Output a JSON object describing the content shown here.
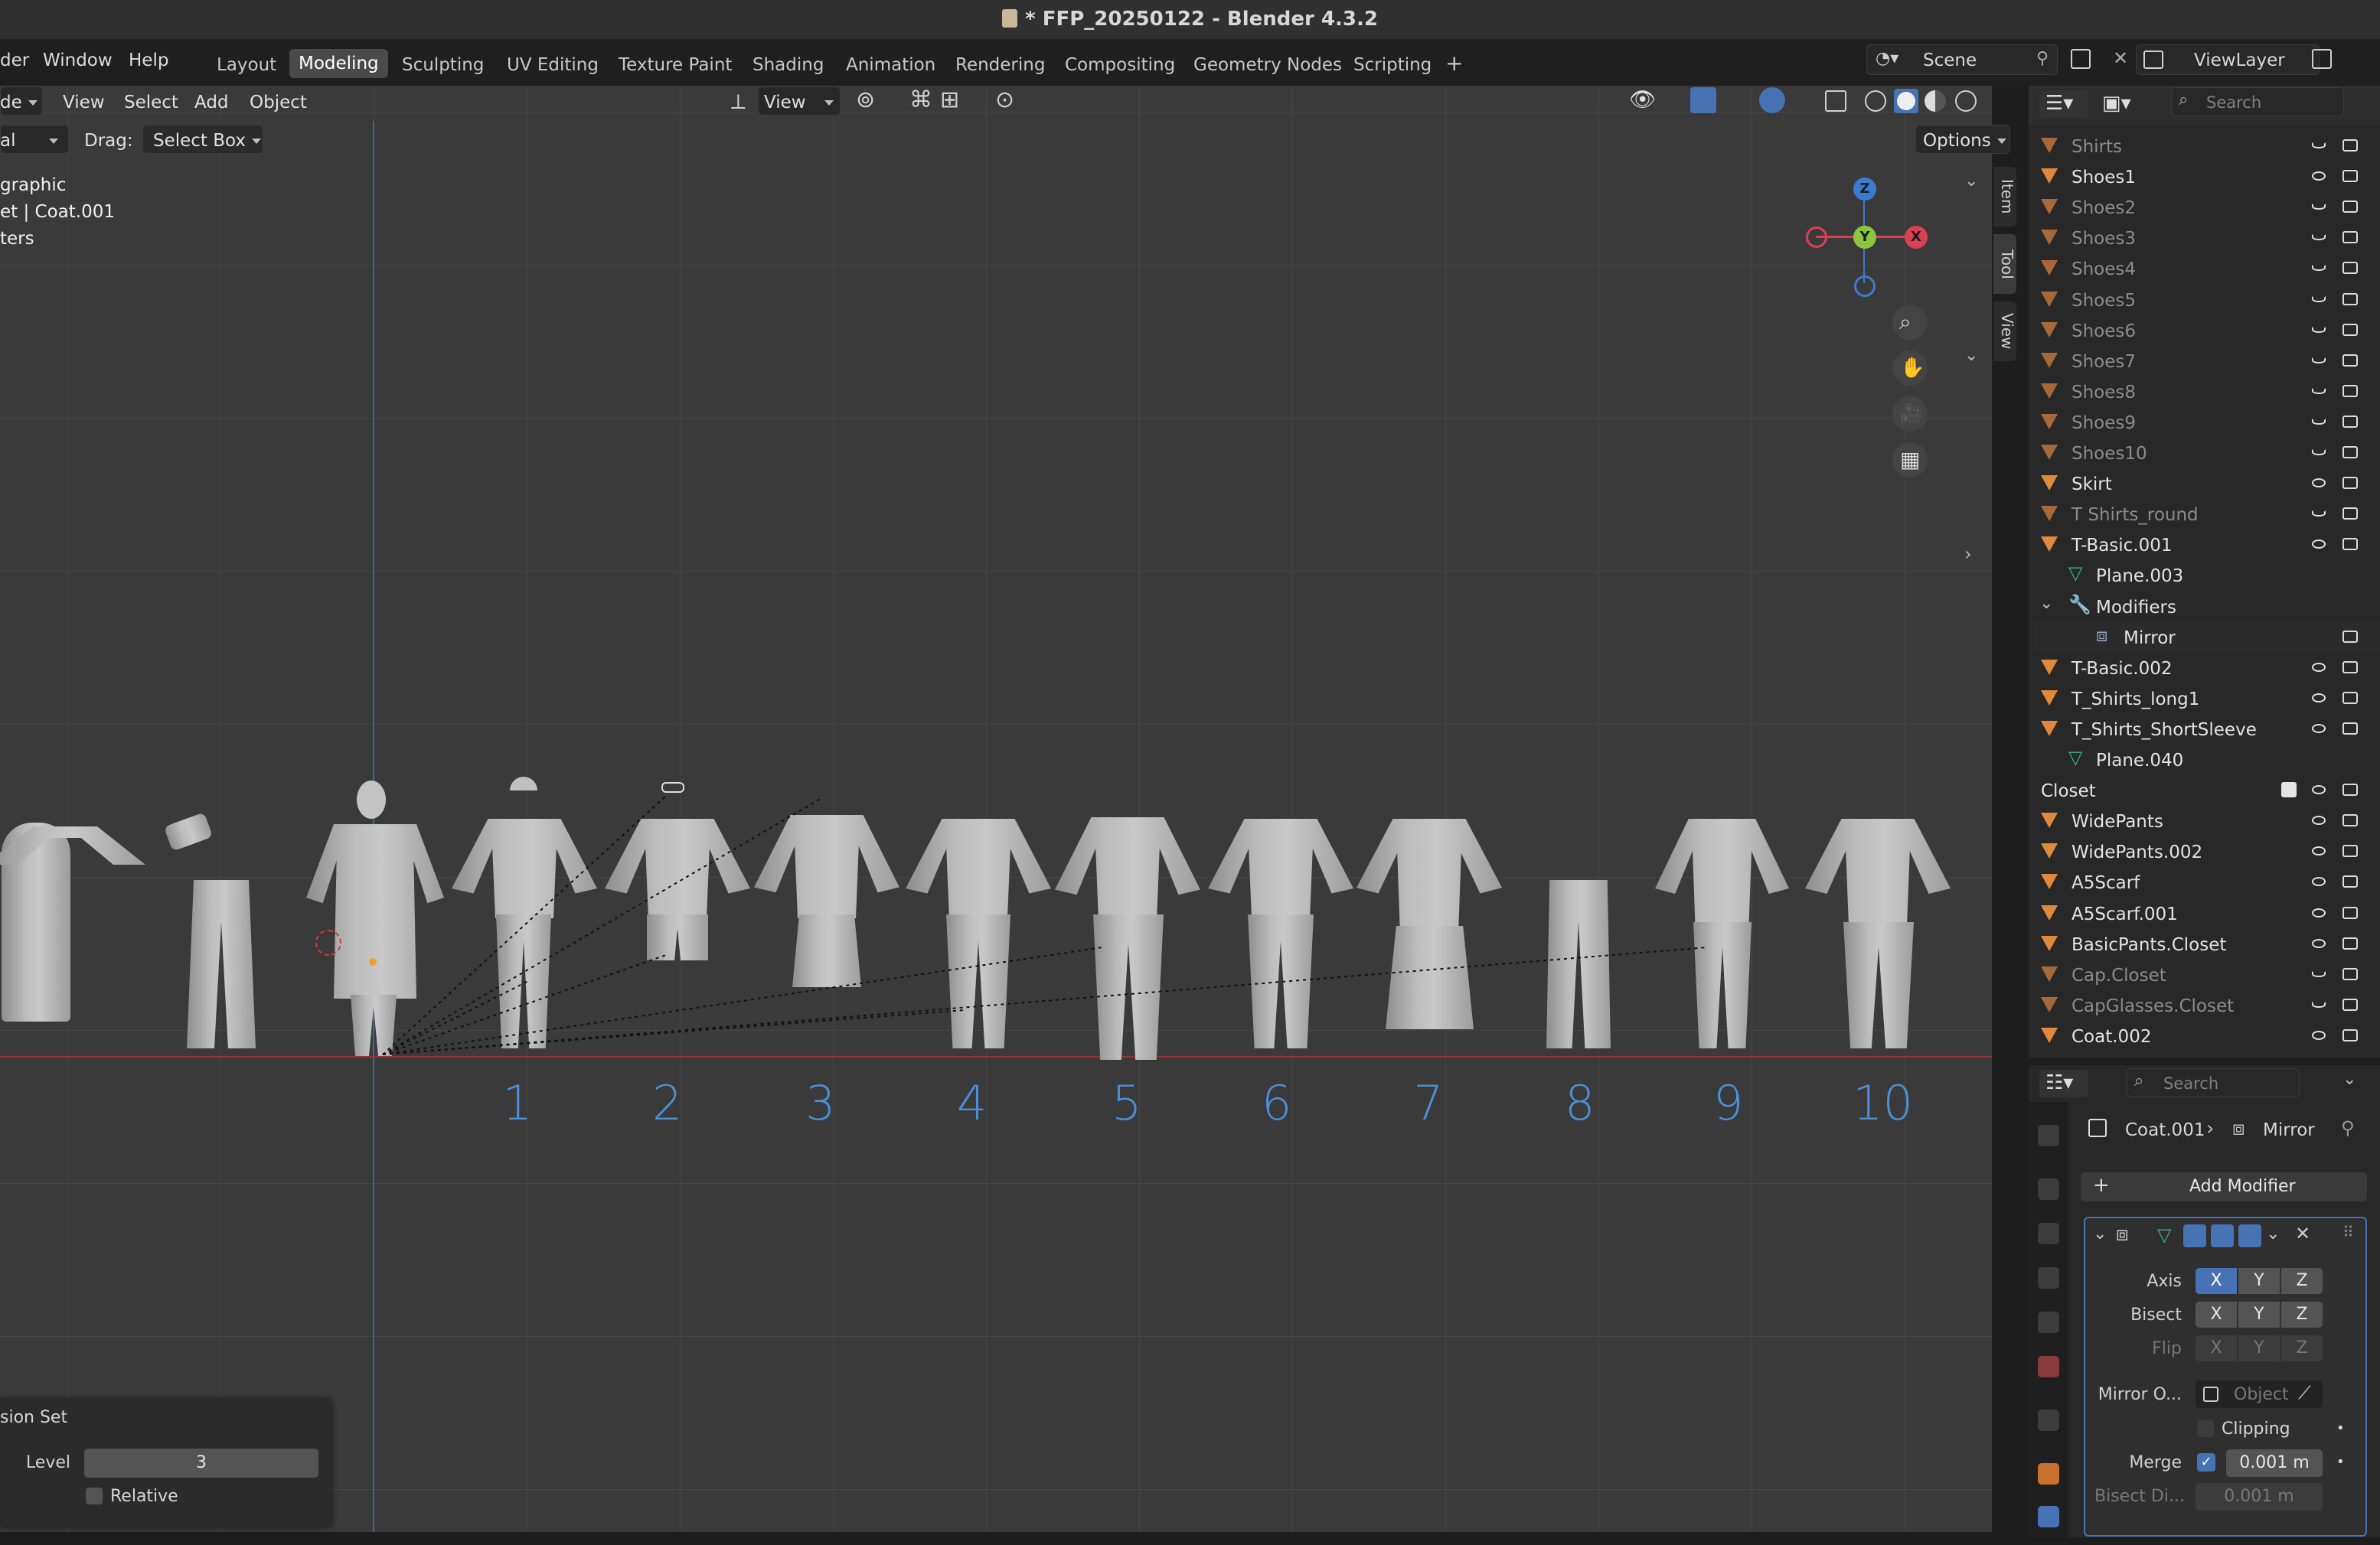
{
  "window": {
    "title": "* FFP_20250122 - Blender 4.3.2"
  },
  "menus": {
    "render": "der",
    "window": "Window",
    "help": "Help"
  },
  "workspaces": [
    "Layout",
    "Modeling",
    "Sculpting",
    "UV Editing",
    "Texture Paint",
    "Shading",
    "Animation",
    "Rendering",
    "Compositing",
    "Geometry Nodes",
    "Scripting"
  ],
  "active_workspace": "Modeling",
  "scene": {
    "label": "Scene",
    "view_layer": "ViewLayer"
  },
  "viewport_header": {
    "mode": "de",
    "view": "View",
    "select": "Select",
    "add": "Add",
    "object": "Object",
    "orientation": "View",
    "drag_label": "Drag:",
    "drag_value": "Select Box",
    "transform_partial": "al",
    "options": "Options"
  },
  "viewport_info": {
    "line1": "graphic",
    "line2": "et | Coat.001",
    "line3": "ters"
  },
  "side_tabs": [
    "Item",
    "Tool",
    "View"
  ],
  "gizmo": {
    "x": "X",
    "y": "Y",
    "z": "Z"
  },
  "ground_numbers": [
    "1",
    "2",
    "3",
    "4",
    "5",
    "6",
    "7",
    "8",
    "9",
    "10"
  ],
  "last_op": {
    "title": "sion Set",
    "level_label": "Level",
    "level_value": "3",
    "relative_label": "Relative"
  },
  "outliner": {
    "search_placeholder": "Search",
    "items": [
      {
        "label": "Shirts",
        "dim": true
      },
      {
        "label": "Shoes1",
        "dim": false
      },
      {
        "label": "Shoes2",
        "dim": true
      },
      {
        "label": "Shoes3",
        "dim": true
      },
      {
        "label": "Shoes4",
        "dim": true
      },
      {
        "label": "Shoes5",
        "dim": true
      },
      {
        "label": "Shoes6",
        "dim": true
      },
      {
        "label": "Shoes7",
        "dim": true
      },
      {
        "label": "Shoes8",
        "dim": true
      },
      {
        "label": "Shoes9",
        "dim": true
      },
      {
        "label": "Shoes10",
        "dim": true
      },
      {
        "label": "Skirt",
        "dim": false
      },
      {
        "label": "T Shirts_round",
        "dim": true
      },
      {
        "label": "T-Basic.001",
        "dim": false
      },
      {
        "label": "Plane.003",
        "dim": false
      },
      {
        "label": "Modifiers",
        "dim": false
      },
      {
        "label": "Mirror",
        "dim": false
      },
      {
        "label": "T-Basic.002",
        "dim": false
      },
      {
        "label": "T_Shirts_long1",
        "dim": false
      },
      {
        "label": "T_Shirts_ShortSleeve",
        "dim": false
      },
      {
        "label": "Plane.040",
        "dim": false
      },
      {
        "label": "Closet",
        "dim": false
      },
      {
        "label": "WidePants",
        "dim": false
      },
      {
        "label": "WidePants.002",
        "dim": false
      },
      {
        "label": "A5Scarf",
        "dim": false
      },
      {
        "label": "A5Scarf.001",
        "dim": false
      },
      {
        "label": "BasicPants.Closet",
        "dim": false
      },
      {
        "label": "Cap.Closet",
        "dim": true
      },
      {
        "label": "CapGlasses.Closet",
        "dim": true
      },
      {
        "label": "Coat.002",
        "dim": false
      }
    ]
  },
  "properties": {
    "search_placeholder": "Search",
    "breadcrumb_object": "Coat.001",
    "breadcrumb_modifier": "Mirror",
    "add_modifier": "Add Modifier",
    "axis_label": "Axis",
    "bisect_label": "Bisect",
    "flip_label": "Flip",
    "axes": [
      "X",
      "Y",
      "Z"
    ],
    "mirror_object_label": "Mirror O...",
    "mirror_object_placeholder": "Object",
    "clipping_label": "Clipping",
    "merge_label": "Merge",
    "merge_value": "0.001 m",
    "bisect_distance_label": "Bisect Di...",
    "bisect_distance_value": "0.001 m"
  },
  "colors": {
    "accent": "#4772b3",
    "object_orange": "#e0893c",
    "mesh_green": "#38b38a",
    "numbers_blue": "#4b8fd6",
    "x_axis_red": "#d94150",
    "y_axis_green": "#8cc63f",
    "z_axis_blue": "#3b7bd1"
  }
}
